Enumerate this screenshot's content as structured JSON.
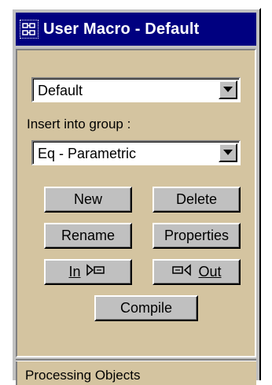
{
  "window": {
    "title": "User Macro - Default",
    "icon": "macro-window-icon"
  },
  "macro_select": {
    "value": "Default",
    "icon": "chevron-down-icon"
  },
  "group": {
    "label": "Insert into group :",
    "value": "Eq - Parametric",
    "icon": "chevron-down-icon"
  },
  "buttons": {
    "new": "New",
    "delete": "Delete",
    "rename": "Rename",
    "properties": "Properties",
    "in": "In",
    "out": "Out",
    "compile": "Compile"
  },
  "section": {
    "processing_objects": "Processing Objects"
  },
  "colors": {
    "titlebar": "#000080",
    "panel": "#d4c4a0",
    "face": "#c0c0c0"
  }
}
